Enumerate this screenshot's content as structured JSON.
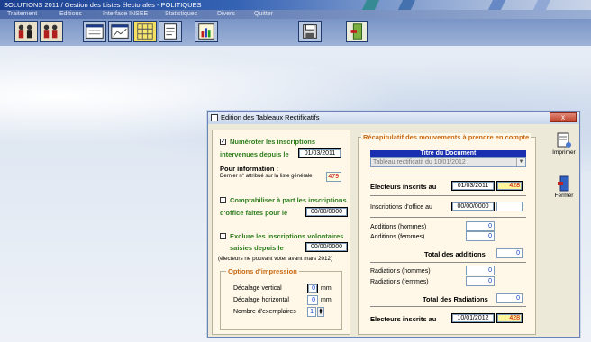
{
  "window": {
    "title": "SOLUTIONS 2011 / Gestion des Listes électorales - POLITIQUES"
  },
  "menu": [
    "Traitement",
    "Editions",
    "Interface INSEE",
    "Statistiques",
    "Divers",
    "Quitter"
  ],
  "toolbar_icons": [
    "people-icon",
    "people-icon",
    "window-icon",
    "chart-window-icon",
    "grid-icon",
    "form-icon",
    "bar-chart-icon",
    "printer-icon",
    "exit-door-icon"
  ],
  "dialog": {
    "title": "Edition des Tableaux Rectificatifs",
    "close": "x",
    "left": {
      "numeroter": {
        "checked": true,
        "mark": "✓",
        "line1": "Numéroter les inscriptions",
        "line2": "intervenues depuis le",
        "date": "01/03/2011"
      },
      "info": {
        "heading": "Pour information :",
        "text": "Dernier n° attribué sur la liste générale",
        "value": "479"
      },
      "comptabiliser": {
        "checked": false,
        "line1": "Comptabiliser à part les inscriptions",
        "line2": "d'office faites pour le",
        "date": "00/00/0000"
      },
      "exclure": {
        "checked": false,
        "line1": "Exclure les inscriptions volontaires",
        "line2": "saisies depuis le",
        "date": "00/00/0000",
        "note": "(électeurs ne pouvant voter avant mars 2012)"
      },
      "options": {
        "legend": "Options d'impression",
        "vertical_label": "Décalage vertical",
        "vertical_value": "0",
        "horizontal_label": "Décalage horizontal",
        "horizontal_value": "0",
        "unit": "mm",
        "copies_label": "Nombre d'exemplaires",
        "copies_value": "1"
      }
    },
    "right": {
      "legend": "Récapitulatif des mouvements à prendre en compte",
      "doc_title_header": "Titre du Document",
      "doc_title_value": "Tableau rectificatif du 10/01/2012",
      "electeurs_inscrits_label": "Electeurs inscrits au",
      "electeurs_inscrits_date": "01/03/2011",
      "electeurs_inscrits_count": "428",
      "inscriptions_office_label": "Inscriptions d'office au",
      "inscriptions_office_date": "00/00/0000",
      "inscriptions_office_count": "",
      "additions_hommes_label": "Additions (hommes)",
      "additions_hommes_value": "0",
      "additions_femmes_label": "Additions (femmes)",
      "additions_femmes_value": "0",
      "total_additions_label": "Total des additions",
      "total_additions_value": "0",
      "radiations_hommes_label": "Radiations (hommes)",
      "radiations_hommes_value": "0",
      "radiations_femmes_label": "Radiations (femmes)",
      "radiations_femmes_value": "0",
      "total_radiations_label": "Total des Radiations",
      "total_radiations_value": "0",
      "electeurs_final_label": "Electeurs inscrits au",
      "electeurs_final_date": "10/01/2012",
      "electeurs_final_count": "428"
    },
    "buttons": {
      "print": "Imprimer",
      "close": "Fermer"
    }
  }
}
